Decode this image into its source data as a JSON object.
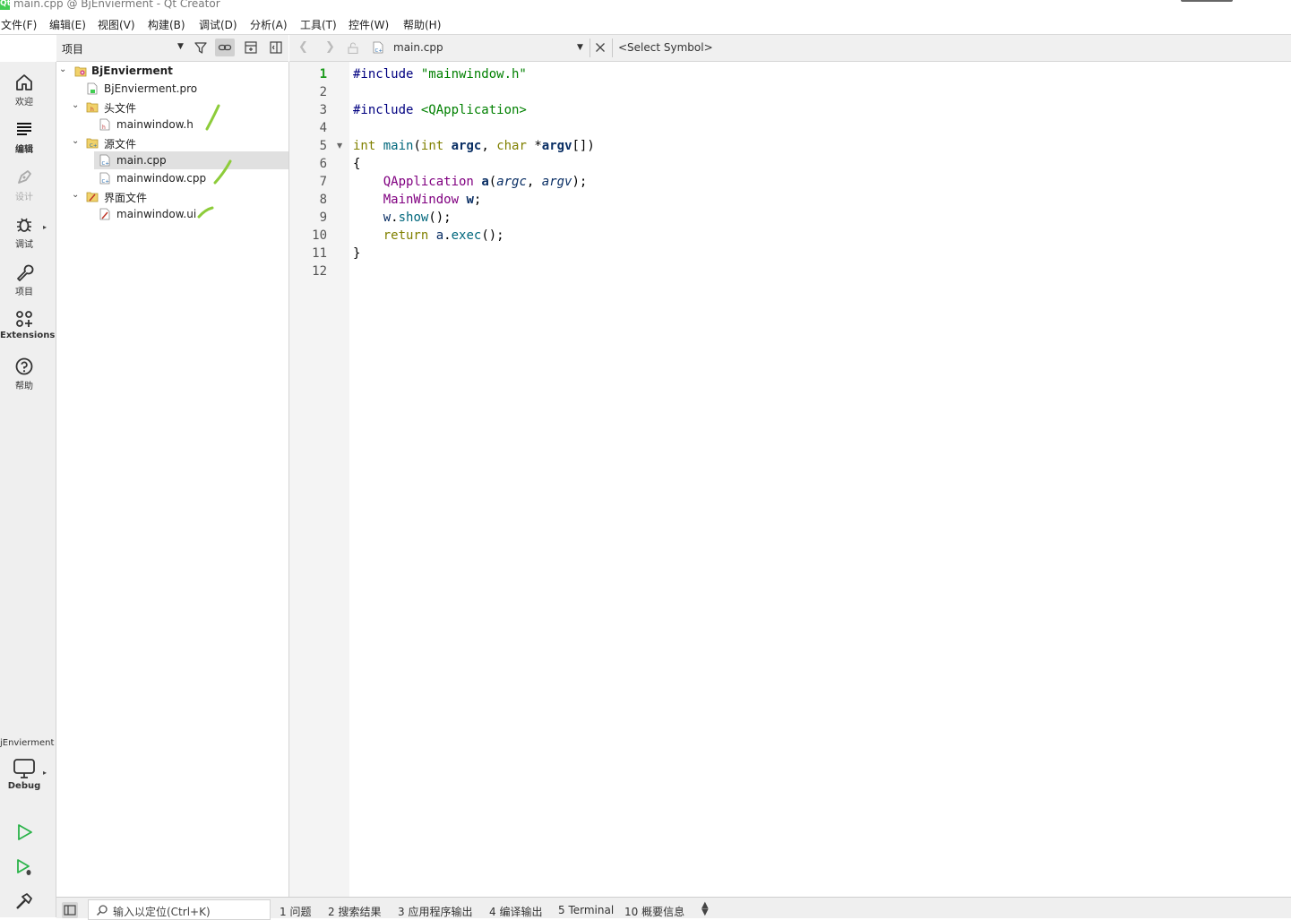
{
  "window": {
    "app_icon_text": "Qt",
    "title": "main.cpp @ BjEnvierment - Qt Creator"
  },
  "menu": [
    "文件(F)",
    "编辑(E)",
    "视图(V)",
    "构建(B)",
    "调试(D)",
    "分析(A)",
    "工具(T)",
    "控件(W)",
    "帮助(H)"
  ],
  "modes": [
    {
      "label": "欢迎",
      "icon": "home-icon"
    },
    {
      "label": "编辑",
      "icon": "edit-lines-icon"
    },
    {
      "label": "设计",
      "icon": "pen-icon"
    },
    {
      "label": "调试",
      "icon": "bug-icon"
    },
    {
      "label": "项目",
      "icon": "wrench-icon"
    },
    {
      "label": "Extensions",
      "icon": "extensions-icon"
    },
    {
      "label": "帮助",
      "icon": "help-icon"
    }
  ],
  "kit": {
    "project_name": "jEnvierment",
    "build_config": "Debug"
  },
  "project_panel": {
    "view_selector": "项目"
  },
  "tree": [
    {
      "label": "BjEnvierment",
      "level": 0,
      "expanded": true,
      "icon": "project-icon",
      "bold": true
    },
    {
      "label": "BjEnvierment.pro",
      "level": 1,
      "icon": "pro-file-icon"
    },
    {
      "label": "头文件",
      "level": 1,
      "expanded": true,
      "icon": "header-folder-icon"
    },
    {
      "label": "mainwindow.h",
      "level": 2,
      "icon": "header-file-icon"
    },
    {
      "label": "源文件",
      "level": 1,
      "expanded": true,
      "icon": "source-folder-icon"
    },
    {
      "label": "main.cpp",
      "level": 2,
      "icon": "cpp-file-icon",
      "selected": true
    },
    {
      "label": "mainwindow.cpp",
      "level": 2,
      "icon": "cpp-file-icon"
    },
    {
      "label": "界面文件",
      "level": 1,
      "expanded": true,
      "icon": "forms-folder-icon"
    },
    {
      "label": "mainwindow.ui",
      "level": 2,
      "icon": "ui-file-icon"
    }
  ],
  "editor": {
    "open_file": "main.cpp",
    "symbol": "<Select Symbol>",
    "current_line": 1,
    "line_numbers": [
      "1",
      "2",
      "3",
      "4",
      "5",
      "6",
      "7",
      "8",
      "9",
      "10",
      "11",
      "12"
    ],
    "code": {
      "l1_directive": "#include ",
      "l1_path": "\"mainwindow.h\"",
      "l3_directive": "#include ",
      "l3_path": "<QApplication>",
      "l5_type": "int",
      "l5_func": "main",
      "l5_open": "(",
      "l5_type2": "int",
      "l5_argc": "argc",
      "l5_comma": ", ",
      "l5_char": "char",
      "l5_star": " *",
      "l5_argv": "argv",
      "l5_close": "[])",
      "l6": "{",
      "l7_type": "QApplication",
      "l7_var": "a",
      "l7_open": "(",
      "l7_argc": "argc",
      "l7_comma": ", ",
      "l7_argv": "argv",
      "l7_close": ");",
      "l8_type": "MainWindow",
      "l8_var": "w",
      "l8_semi": ";",
      "l9_obj": "w",
      "l9_dot": ".",
      "l9_method": "show",
      "l9_rest": "();",
      "l10_kw": "return",
      "l10_obj": "a",
      "l10_dot": ".",
      "l10_method": "exec",
      "l10_rest": "();",
      "l11": "}"
    }
  },
  "statusbar": {
    "locator_placeholder": "输入以定位(Ctrl+K)",
    "output_tabs": [
      "1  问题",
      "2  搜索结果",
      "3  应用程序输出",
      "4  编译输出",
      "5  Terminal",
      "10  概要信息"
    ]
  },
  "colors": {
    "accent_green": "#41cd52",
    "annotation_green": "#8dcc3a",
    "selection": "#e0e0e0"
  }
}
